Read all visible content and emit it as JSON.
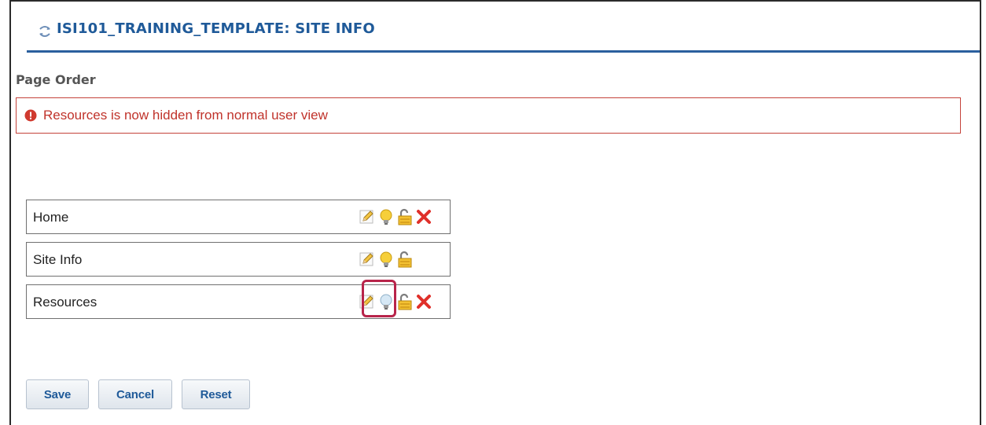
{
  "header": {
    "title": "ISI101_TRAINING_TEMPLATE: SITE INFO",
    "icon": "sync-arrows-icon",
    "color": "#1f5a99"
  },
  "section": {
    "title": "Page Order"
  },
  "alert": {
    "icon": "alert-circle-icon",
    "message": "Resources is now hidden from normal user view",
    "color": "#c0332b"
  },
  "pages": [
    {
      "label": "Home",
      "tools": [
        "edit-pencil-icon",
        "lightbulb-visible-icon",
        "unlocked-padlock-icon",
        "delete-x-icon"
      ],
      "hidden": false
    },
    {
      "label": "Site Info",
      "tools": [
        "edit-pencil-icon",
        "lightbulb-visible-icon",
        "unlocked-padlock-icon"
      ],
      "hidden": false
    },
    {
      "label": "Resources",
      "tools": [
        "edit-pencil-icon",
        "lightbulb-hidden-icon",
        "unlocked-padlock-icon",
        "delete-x-icon"
      ],
      "hidden": true
    }
  ],
  "buttons": {
    "save": "Save",
    "cancel": "Cancel",
    "reset": "Reset"
  },
  "colors": {
    "accent": "#2b5f9e",
    "highlight": "#b8244a",
    "delete": "#e0302a",
    "bulb_on": "#f2c230",
    "bulb_off": "#cfe3f2"
  }
}
